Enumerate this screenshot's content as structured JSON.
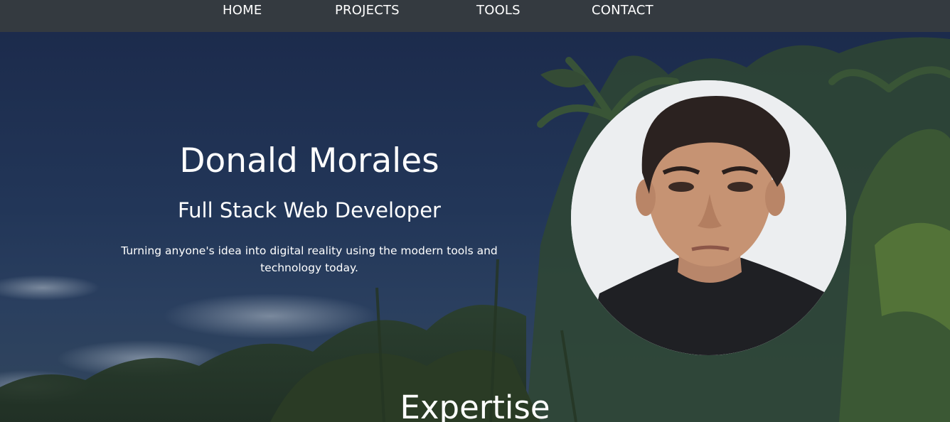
{
  "nav": {
    "items": [
      {
        "label": "HOME"
      },
      {
        "label": "PROJECTS"
      },
      {
        "label": "TOOLS"
      },
      {
        "label": "CONTACT"
      }
    ]
  },
  "hero": {
    "name": "Donald Morales",
    "role": "Full Stack Web Developer",
    "tagline": "Turning anyone's idea into digital reality using the modern tools and technology today."
  },
  "sections": {
    "expertise_title": "Expertise"
  },
  "colors": {
    "navbar_bg": "#343a40",
    "hero_overlay": "#1d2c4a",
    "text": "#ffffff"
  }
}
